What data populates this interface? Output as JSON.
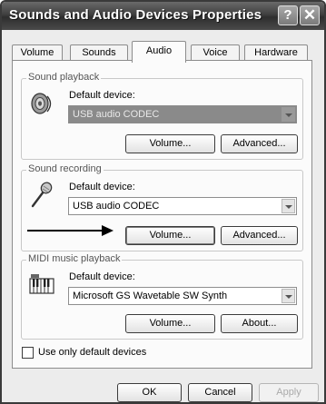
{
  "window": {
    "title": "Sounds and Audio Devices Properties",
    "help_glyph": "?",
    "close_glyph": "✕"
  },
  "tabs": [
    {
      "label": "Volume",
      "active": false
    },
    {
      "label": "Sounds",
      "active": false
    },
    {
      "label": "Audio",
      "active": true
    },
    {
      "label": "Voice",
      "active": false
    },
    {
      "label": "Hardware",
      "active": false
    }
  ],
  "playback": {
    "group_label": "Sound playback",
    "default_label": "Default device:",
    "device": "USB audio CODEC",
    "volume_label": "Volume...",
    "advanced_label": "Advanced...",
    "icon": "speaker-icon"
  },
  "recording": {
    "group_label": "Sound recording",
    "default_label": "Default device:",
    "device": "USB audio CODEC",
    "volume_label": "Volume...",
    "advanced_label": "Advanced...",
    "icon": "microphone-icon"
  },
  "midi": {
    "group_label": "MIDI music playback",
    "default_label": "Default device:",
    "device": "Microsoft GS Wavetable SW Synth",
    "volume_label": "Volume...",
    "about_label": "About...",
    "icon": "keyboard-icon"
  },
  "options": {
    "use_default_label": "Use only default devices",
    "use_default_checked": false
  },
  "footer": {
    "ok_label": "OK",
    "cancel_label": "Cancel",
    "apply_label": "Apply"
  }
}
